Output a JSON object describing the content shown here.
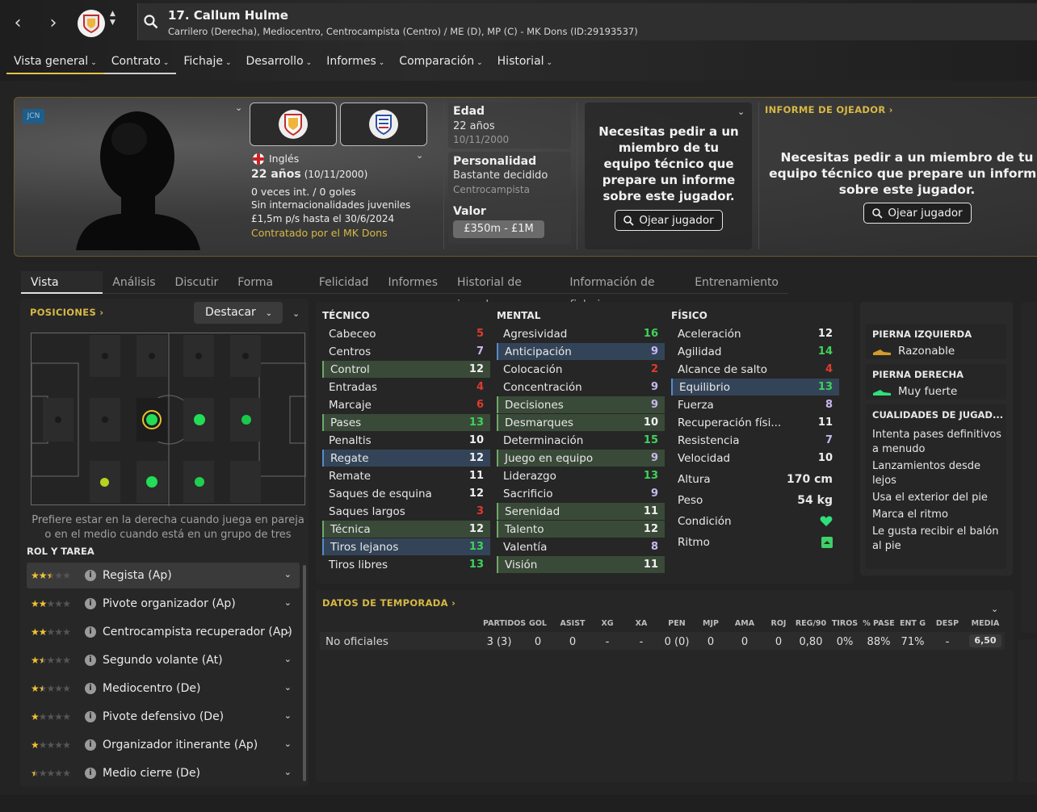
{
  "header": {
    "back_icon": "chevron-left-icon",
    "forward_icon": "chevron-right-icon",
    "player_name": "17. Callum Hulme",
    "player_description": "Carrilero (Derecha), Mediocentro, Centrocampista (Centro) / ME (D), MP (C) - MK Dons (ID:29193537)"
  },
  "main_nav": [
    {
      "label": "Vista general"
    },
    {
      "label": "Contrato"
    },
    {
      "label": "Fichaje"
    },
    {
      "label": "Desarrollo"
    },
    {
      "label": "Informes"
    },
    {
      "label": "Comparación"
    },
    {
      "label": "Historial"
    }
  ],
  "profile": {
    "tag": "JCN",
    "nationality": "Inglés",
    "age_line": "22 años",
    "age_date": "(10/11/2000)",
    "caps": "0 veces int. / 0 goles",
    "youth_caps": "Sin internacionalidades juveniles",
    "contract": "£1,5m p/s hasta el 30/6/2024",
    "signed_by": "Contratado por el MK Dons",
    "edad_label": "Edad",
    "edad_value": "22 años",
    "edad_date": "10/11/2000",
    "personality_label": "Personalidad",
    "personality_value": "Bastante decidido",
    "personality_role": "Centrocampista",
    "value_label": "Valor",
    "value_range": "£350m - £1M",
    "staff_message": "Necesitas pedir a un miembro de tu equipo técnico que prepare un informe sobre este jugador.",
    "scout_button": "Ojear jugador",
    "scout_report_title": "INFORME DE OJEADOR",
    "scout_report_message": "Necesitas pedir a un miembro de tu equipo técnico que prepare un informe sobre este jugador.",
    "scout_report_button": "Ojear jugador"
  },
  "sub_tabs": [
    {
      "label": "Vista general"
    },
    {
      "label": "Análisis"
    },
    {
      "label": "Discutir"
    },
    {
      "label": "Forma actual"
    },
    {
      "label": "Felicidad"
    },
    {
      "label": "Informes"
    },
    {
      "label": "Historial de jugador"
    },
    {
      "label": "Información de fichaje"
    },
    {
      "label": "Entrenamiento"
    }
  ],
  "positions": {
    "title": "POSICIONES",
    "highlight_dropdown": "Destacar",
    "note": "Prefiere estar en la derecha cuando juega en pareja o en el medio cuando está en un grupo de tres",
    "roles_title": "ROL Y TAREA",
    "roles": [
      {
        "stars": 2.5,
        "name": "Regista (Ap)"
      },
      {
        "stars": 2,
        "name": "Pivote organizador (Ap)"
      },
      {
        "stars": 2,
        "name": "Centrocampista recuperador (Ap)"
      },
      {
        "stars": 1.5,
        "name": "Segundo volante (At)"
      },
      {
        "stars": 1.5,
        "name": "Mediocentro (De)"
      },
      {
        "stars": 1,
        "name": "Pivote defensivo (De)"
      },
      {
        "stars": 1,
        "name": "Organizador itinerante (Ap)"
      },
      {
        "stars": 0.5,
        "name": "Medio cierre (De)"
      }
    ]
  },
  "attributes": {
    "technical_title": "TÉCNICO",
    "mental_title": "MENTAL",
    "physical_title": "FÍSICO",
    "technical": [
      {
        "name": "Cabeceo",
        "value": "5",
        "hl": ""
      },
      {
        "name": "Centros",
        "value": "7",
        "hl": ""
      },
      {
        "name": "Control",
        "value": "12",
        "hl": "g"
      },
      {
        "name": "Entradas",
        "value": "4",
        "hl": ""
      },
      {
        "name": "Marcaje",
        "value": "6",
        "hl": ""
      },
      {
        "name": "Pases",
        "value": "13",
        "hl": "g"
      },
      {
        "name": "Penaltis",
        "value": "10",
        "hl": ""
      },
      {
        "name": "Regate",
        "value": "12",
        "hl": "b"
      },
      {
        "name": "Remate",
        "value": "11",
        "hl": ""
      },
      {
        "name": "Saques de esquina",
        "value": "12",
        "hl": ""
      },
      {
        "name": "Saques largos",
        "value": "3",
        "hl": ""
      },
      {
        "name": "Técnica",
        "value": "12",
        "hl": "g"
      },
      {
        "name": "Tiros lejanos",
        "value": "13",
        "hl": "b"
      },
      {
        "name": "Tiros libres",
        "value": "13",
        "hl": ""
      }
    ],
    "mental": [
      {
        "name": "Agresividad",
        "value": "16",
        "hl": ""
      },
      {
        "name": "Anticipación",
        "value": "9",
        "hl": "b"
      },
      {
        "name": "Colocación",
        "value": "2",
        "hl": ""
      },
      {
        "name": "Concentración",
        "value": "9",
        "hl": ""
      },
      {
        "name": "Decisiones",
        "value": "9",
        "hl": "g"
      },
      {
        "name": "Desmarques",
        "value": "10",
        "hl": "g"
      },
      {
        "name": "Determinación",
        "value": "15",
        "hl": ""
      },
      {
        "name": "Juego en equipo",
        "value": "9",
        "hl": "g"
      },
      {
        "name": "Liderazgo",
        "value": "13",
        "hl": ""
      },
      {
        "name": "Sacrificio",
        "value": "9",
        "hl": ""
      },
      {
        "name": "Serenidad",
        "value": "11",
        "hl": "g"
      },
      {
        "name": "Talento",
        "value": "12",
        "hl": "g"
      },
      {
        "name": "Valentía",
        "value": "8",
        "hl": ""
      },
      {
        "name": "Visión",
        "value": "11",
        "hl": "g"
      }
    ],
    "physical": [
      {
        "name": "Aceleración",
        "value": "12",
        "hl": ""
      },
      {
        "name": "Agilidad",
        "value": "14",
        "hl": ""
      },
      {
        "name": "Alcance de salto",
        "value": "4",
        "hl": ""
      },
      {
        "name": "Equilibrio",
        "value": "13",
        "hl": "b"
      },
      {
        "name": "Fuerza",
        "value": "8",
        "hl": ""
      },
      {
        "name": "Recuperación físi...",
        "value": "11",
        "hl": ""
      },
      {
        "name": "Resistencia",
        "value": "7",
        "hl": ""
      },
      {
        "name": "Velocidad",
        "value": "10",
        "hl": ""
      }
    ],
    "height_label": "Altura",
    "height_value": "170 cm",
    "weight_label": "Peso",
    "weight_value": "54 kg",
    "condition_label": "Condición",
    "rhythm_label": "Ritmo"
  },
  "feet": {
    "left_title": "PIERNA IZQUIERDA",
    "left_value": "Razonable",
    "right_title": "PIERNA DERECHA",
    "right_value": "Muy fuerte",
    "traits_title": "CUALIDADES DE JUGAD...",
    "traits": [
      "Intenta pases definitivos a menudo",
      "Lanzamientos desde lejos",
      "Usa el exterior del pie",
      "Marca el ritmo",
      "Le gusta recibir el balón al pie"
    ]
  },
  "season": {
    "title": "DATOS DE TEMPORADA",
    "headers": [
      "PARTIDOS",
      "GOL",
      "ASIST",
      "XG",
      "XA",
      "PEN",
      "MJP",
      "AMA",
      "ROJ",
      "REG/90",
      "TIROS",
      "% PASE",
      "ENT G",
      "DESP",
      "MEDIA"
    ],
    "row_label": "No oficiales",
    "values": [
      "3 (3)",
      "0",
      "0",
      "-",
      "-",
      "0 (0)",
      "0",
      "0",
      "0",
      "0,80",
      "0%",
      "88%",
      "71%",
      "-",
      "6,50"
    ]
  },
  "colors": {
    "accent_gold": "#d8b845",
    "attr_red": "#e03a2f",
    "attr_green": "#3ed35a",
    "highlight_green": "#3a4a38",
    "highlight_blue": "#344458"
  }
}
